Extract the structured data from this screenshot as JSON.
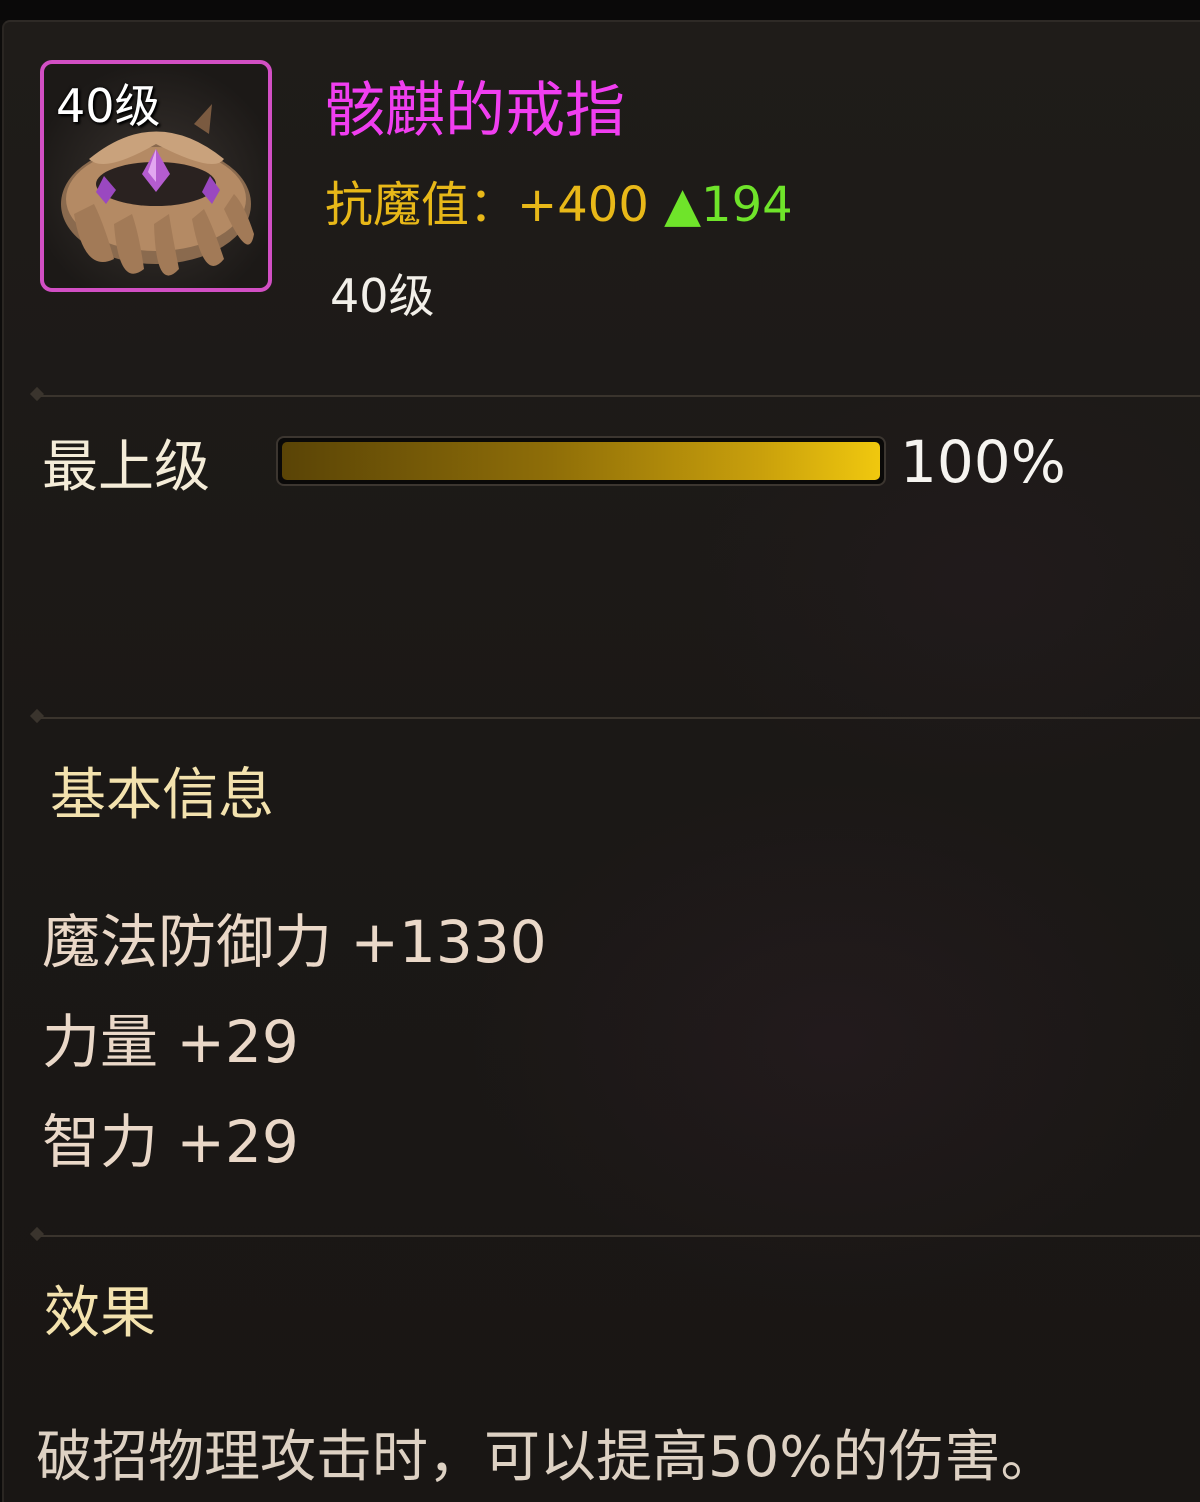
{
  "item": {
    "icon_level": "40级",
    "icon_name": "bone-ring-icon",
    "name": "骸麒的戒指",
    "name_color": "#f03ef0",
    "frame_color": "#d24fc4",
    "resist_label": "抗魔值：",
    "resist_value": "+400",
    "resist_change": "▲194",
    "req_level": "40级"
  },
  "grade": {
    "label": "最上级",
    "percent_text": "100%",
    "fill": 1.0
  },
  "basic_info": {
    "title": "基本信息",
    "attributes": [
      "魔法防御力 +1330",
      "力量 +29",
      "智力 +29"
    ]
  },
  "effect": {
    "title": "效果",
    "text": "破招物理攻击时，可以提高50%的伤害。"
  }
}
